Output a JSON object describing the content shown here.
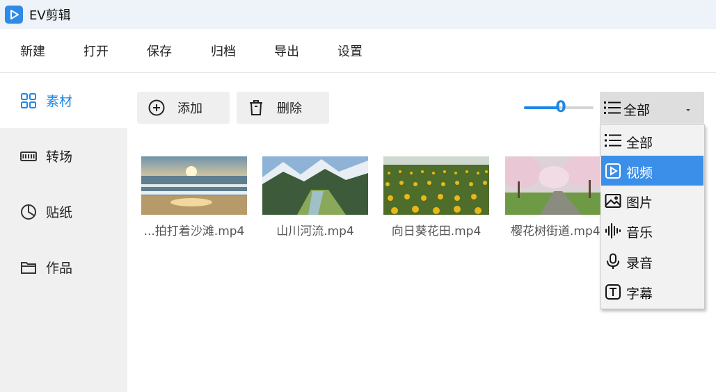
{
  "app": {
    "title": "EV剪辑",
    "logo_icon": "play-logo-icon",
    "accent": "#1e88e5"
  },
  "menu": [
    "新建",
    "打开",
    "保存",
    "归档",
    "导出",
    "设置"
  ],
  "sidebar": {
    "items": [
      {
        "label": "素材",
        "icon": "grid-icon",
        "active": true
      },
      {
        "label": "转场",
        "icon": "filmstrip-icon",
        "active": false
      },
      {
        "label": "贴纸",
        "icon": "pie-icon",
        "active": false
      },
      {
        "label": "作品",
        "icon": "folder-icon",
        "active": false
      }
    ]
  },
  "toolbar": {
    "add_label": "添加",
    "delete_label": "删除",
    "slider_value": "0",
    "filter_selected": "全部"
  },
  "dropdown": {
    "options": [
      {
        "label": "全部",
        "icon": "list-icon"
      },
      {
        "label": "视频",
        "icon": "video-icon",
        "selected": true
      },
      {
        "label": "图片",
        "icon": "image-icon"
      },
      {
        "label": "音乐",
        "icon": "audio-wave-icon"
      },
      {
        "label": "录音",
        "icon": "microphone-icon"
      },
      {
        "label": "字幕",
        "icon": "text-icon"
      }
    ]
  },
  "media": [
    {
      "name": "...拍打着沙滩.mp4",
      "scene": "beach-sunset"
    },
    {
      "name": "山川河流.mp4",
      "scene": "mountain-river"
    },
    {
      "name": "向日葵花田.mp4",
      "scene": "sunflower-field"
    },
    {
      "name": "樱花树街道.mp4",
      "scene": "cherry-blossom-street"
    }
  ]
}
